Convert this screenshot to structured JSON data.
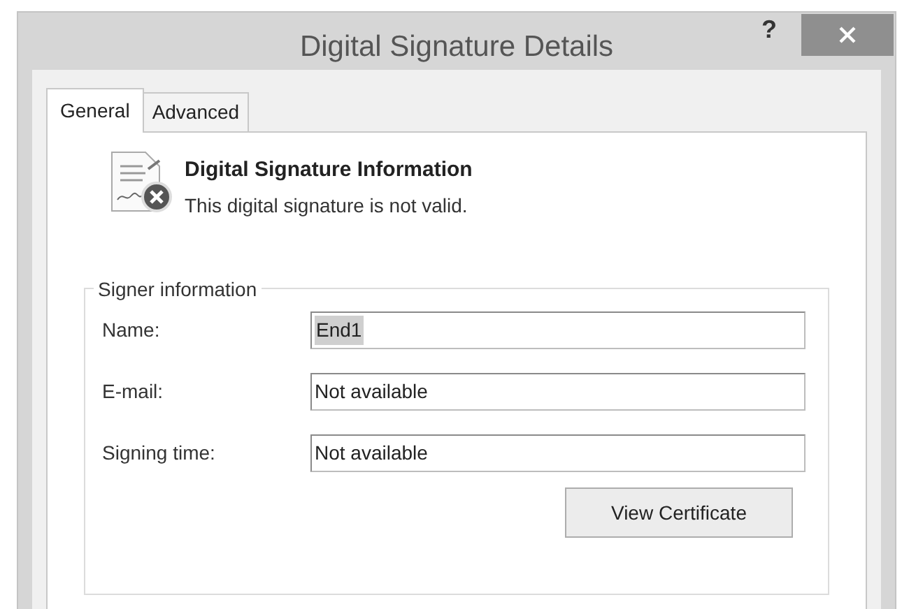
{
  "window": {
    "title": "Digital Signature Details",
    "help": "?"
  },
  "tabs": [
    {
      "label": "General",
      "selected": true
    },
    {
      "label": "Advanced",
      "selected": false
    }
  ],
  "status": {
    "heading": "Digital Signature Information",
    "message": "This digital signature is not valid.",
    "valid": false
  },
  "signer_group": {
    "title": "Signer information",
    "fields": [
      {
        "label": "Name:",
        "value": "End1",
        "selected": true
      },
      {
        "label": "E-mail:",
        "value": "Not available",
        "selected": false
      },
      {
        "label": "Signing time:",
        "value": "Not available",
        "selected": false
      }
    ],
    "button": "View Certificate"
  }
}
